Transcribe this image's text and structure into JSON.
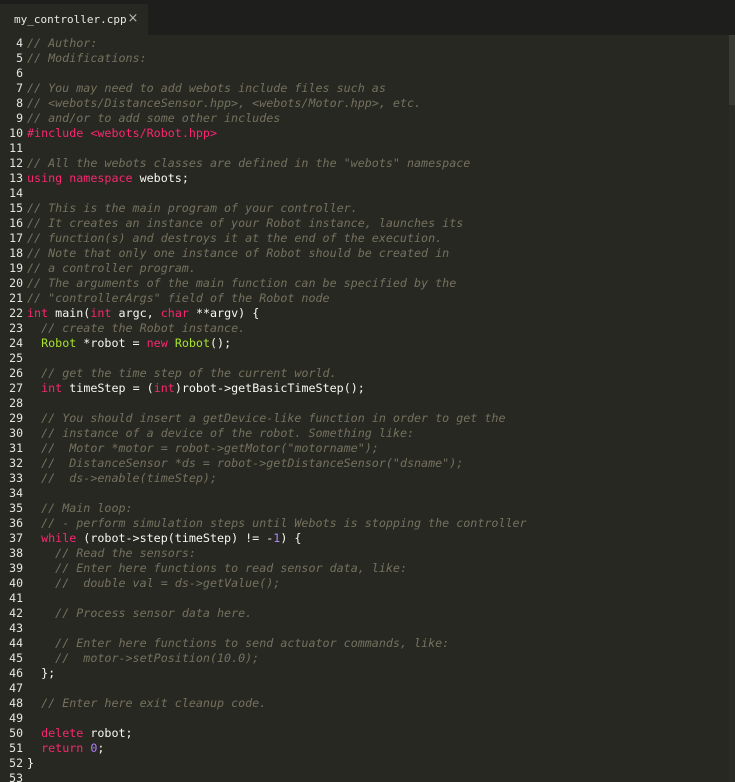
{
  "tab": {
    "label": "my_controller.cpp",
    "close_glyph": "×"
  },
  "colors": {
    "background": "#272822",
    "comment": "#75715e",
    "keyword": "#f92672",
    "type": "#66d9ef",
    "string": "#e6db74",
    "number": "#ae81ff",
    "function": "#a6e22e",
    "text": "#f8f8f2"
  },
  "editor": {
    "lines": [
      {
        "n": "4",
        "t": [
          [
            "cm",
            "// Author:"
          ]
        ]
      },
      {
        "n": "5",
        "t": [
          [
            "cm",
            "// Modifications:"
          ]
        ]
      },
      {
        "n": "6",
        "t": []
      },
      {
        "n": "7",
        "t": [
          [
            "cm",
            "// You may need to add webots include files such as"
          ]
        ]
      },
      {
        "n": "8",
        "t": [
          [
            "cm",
            "// <webots/DistanceSensor.hpp>, <webots/Motor.hpp>, etc."
          ]
        ]
      },
      {
        "n": "9",
        "t": [
          [
            "cm",
            "// and/or to add some other includes"
          ]
        ]
      },
      {
        "n": "10",
        "t": [
          [
            "kw",
            "#include"
          ],
          [
            "tx",
            " "
          ],
          [
            "kw",
            "<webots/Robot.hpp>"
          ]
        ]
      },
      {
        "n": "11",
        "t": []
      },
      {
        "n": "12",
        "t": [
          [
            "cm",
            "// All the webots classes are defined in the \"webots\" namespace"
          ]
        ]
      },
      {
        "n": "13",
        "t": [
          [
            "kw",
            "using namespace"
          ],
          [
            "tx",
            " webots;"
          ]
        ]
      },
      {
        "n": "14",
        "t": []
      },
      {
        "n": "15",
        "t": [
          [
            "cm",
            "// This is the main program of your controller."
          ]
        ]
      },
      {
        "n": "16",
        "t": [
          [
            "cm",
            "// It creates an instance of your Robot instance, launches its"
          ]
        ]
      },
      {
        "n": "17",
        "t": [
          [
            "cm",
            "// function(s) and destroys it at the end of the execution."
          ]
        ]
      },
      {
        "n": "18",
        "t": [
          [
            "cm",
            "// Note that only one instance of Robot should be created in"
          ]
        ]
      },
      {
        "n": "19",
        "t": [
          [
            "cm",
            "// a controller program."
          ]
        ]
      },
      {
        "n": "20",
        "t": [
          [
            "cm",
            "// The arguments of the main function can be specified by the"
          ]
        ]
      },
      {
        "n": "21",
        "t": [
          [
            "cm",
            "// \"controllerArgs\" field of the Robot node"
          ]
        ]
      },
      {
        "n": "22",
        "t": [
          [
            "kw",
            "int"
          ],
          [
            "tx",
            " main("
          ],
          [
            "kw",
            "int"
          ],
          [
            "tx",
            " argc, "
          ],
          [
            "kw",
            "char"
          ],
          [
            "tx",
            " **argv) {"
          ]
        ]
      },
      {
        "n": "23",
        "t": [
          [
            "tx",
            "  "
          ],
          [
            "cm",
            "// create the Robot instance."
          ]
        ]
      },
      {
        "n": "24",
        "t": [
          [
            "tx",
            "  "
          ],
          [
            "fn",
            "Robot"
          ],
          [
            "tx",
            " *robot = "
          ],
          [
            "kw",
            "new"
          ],
          [
            "tx",
            " "
          ],
          [
            "fn",
            "Robot"
          ],
          [
            "tx",
            "();"
          ]
        ]
      },
      {
        "n": "25",
        "t": []
      },
      {
        "n": "26",
        "t": [
          [
            "tx",
            "  "
          ],
          [
            "cm",
            "// get the time step of the current world."
          ]
        ]
      },
      {
        "n": "27",
        "t": [
          [
            "tx",
            "  "
          ],
          [
            "kw",
            "int"
          ],
          [
            "tx",
            " timeStep = ("
          ],
          [
            "kw",
            "int"
          ],
          [
            "tx",
            ")robot->getBasicTimeStep();"
          ]
        ]
      },
      {
        "n": "28",
        "t": []
      },
      {
        "n": "29",
        "t": [
          [
            "tx",
            "  "
          ],
          [
            "cm",
            "// You should insert a getDevice-like function in order to get the"
          ]
        ]
      },
      {
        "n": "30",
        "t": [
          [
            "tx",
            "  "
          ],
          [
            "cm",
            "// instance of a device of the robot. Something like:"
          ]
        ]
      },
      {
        "n": "31",
        "t": [
          [
            "tx",
            "  "
          ],
          [
            "cm",
            "//  Motor *motor = robot->getMotor(\"motorname\");"
          ]
        ]
      },
      {
        "n": "32",
        "t": [
          [
            "tx",
            "  "
          ],
          [
            "cm",
            "//  DistanceSensor *ds = robot->getDistanceSensor(\"dsname\");"
          ]
        ]
      },
      {
        "n": "33",
        "t": [
          [
            "tx",
            "  "
          ],
          [
            "cm",
            "//  ds->enable(timeStep);"
          ]
        ]
      },
      {
        "n": "34",
        "t": []
      },
      {
        "n": "35",
        "t": [
          [
            "tx",
            "  "
          ],
          [
            "cm",
            "// Main loop:"
          ]
        ]
      },
      {
        "n": "36",
        "t": [
          [
            "tx",
            "  "
          ],
          [
            "cm",
            "// - perform simulation steps until Webots is stopping the controller"
          ]
        ]
      },
      {
        "n": "37",
        "t": [
          [
            "tx",
            "  "
          ],
          [
            "kw",
            "while"
          ],
          [
            "tx",
            " (robot->step(timeStep) != -"
          ],
          [
            "nu",
            "1"
          ],
          [
            "tx",
            ") {"
          ]
        ]
      },
      {
        "n": "38",
        "t": [
          [
            "tx",
            "    "
          ],
          [
            "cm",
            "// Read the sensors:"
          ]
        ]
      },
      {
        "n": "39",
        "t": [
          [
            "tx",
            "    "
          ],
          [
            "cm",
            "// Enter here functions to read sensor data, like:"
          ]
        ]
      },
      {
        "n": "40",
        "t": [
          [
            "tx",
            "    "
          ],
          [
            "cm",
            "//  double val = ds->getValue();"
          ]
        ]
      },
      {
        "n": "41",
        "t": []
      },
      {
        "n": "42",
        "t": [
          [
            "tx",
            "    "
          ],
          [
            "cm",
            "// Process sensor data here."
          ]
        ]
      },
      {
        "n": "43",
        "t": []
      },
      {
        "n": "44",
        "t": [
          [
            "tx",
            "    "
          ],
          [
            "cm",
            "// Enter here functions to send actuator commands, like:"
          ]
        ]
      },
      {
        "n": "45",
        "t": [
          [
            "tx",
            "    "
          ],
          [
            "cm",
            "//  motor->setPosition(10.0);"
          ]
        ]
      },
      {
        "n": "46",
        "t": [
          [
            "tx",
            "  };"
          ]
        ]
      },
      {
        "n": "47",
        "t": []
      },
      {
        "n": "48",
        "t": [
          [
            "tx",
            "  "
          ],
          [
            "cm",
            "// Enter here exit cleanup code."
          ]
        ]
      },
      {
        "n": "49",
        "t": []
      },
      {
        "n": "50",
        "t": [
          [
            "tx",
            "  "
          ],
          [
            "kw",
            "delete"
          ],
          [
            "tx",
            " robot;"
          ]
        ]
      },
      {
        "n": "51",
        "t": [
          [
            "tx",
            "  "
          ],
          [
            "kw",
            "return"
          ],
          [
            "tx",
            " "
          ],
          [
            "nu",
            "0"
          ],
          [
            "tx",
            ";"
          ]
        ]
      },
      {
        "n": "52",
        "t": [
          [
            "tx",
            "}"
          ]
        ]
      },
      {
        "n": "53",
        "t": []
      }
    ]
  }
}
